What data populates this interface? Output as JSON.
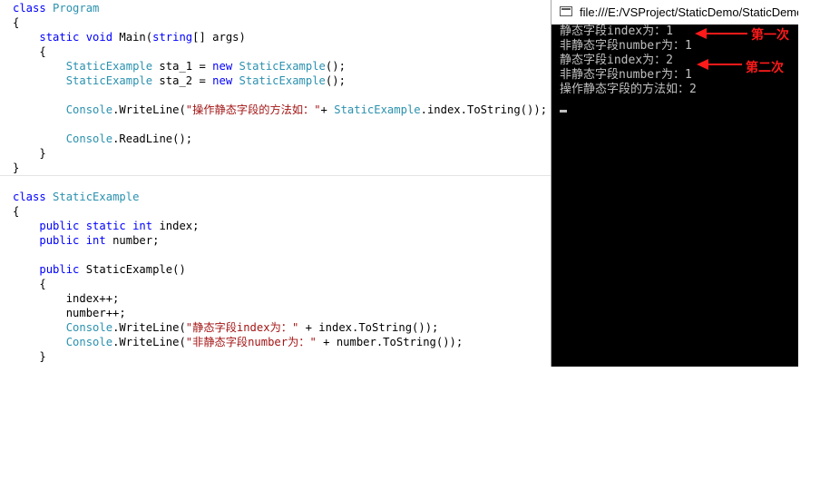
{
  "editor_program": {
    "lines": [
      [
        {
          "t": "class ",
          "c": "kw"
        },
        {
          "t": "Program",
          "c": "tp"
        }
      ],
      [
        {
          "t": "{",
          "c": ""
        }
      ],
      [
        {
          "t": "    ",
          "c": ""
        },
        {
          "t": "static void ",
          "c": "kw"
        },
        {
          "t": "Main(",
          "c": ""
        },
        {
          "t": "string",
          "c": "kw"
        },
        {
          "t": "[] args)",
          "c": ""
        }
      ],
      [
        {
          "t": "    {",
          "c": ""
        }
      ],
      [
        {
          "t": "        ",
          "c": ""
        },
        {
          "t": "StaticExample",
          "c": "tp"
        },
        {
          "t": " sta_1 = ",
          "c": ""
        },
        {
          "t": "new ",
          "c": "kw"
        },
        {
          "t": "StaticExample",
          "c": "tp"
        },
        {
          "t": "();",
          "c": ""
        }
      ],
      [
        {
          "t": "        ",
          "c": ""
        },
        {
          "t": "StaticExample",
          "c": "tp"
        },
        {
          "t": " sta_2 = ",
          "c": ""
        },
        {
          "t": "new ",
          "c": "kw"
        },
        {
          "t": "StaticExample",
          "c": "tp"
        },
        {
          "t": "();",
          "c": ""
        }
      ],
      [
        {
          "t": "",
          "c": ""
        }
      ],
      [
        {
          "t": "        ",
          "c": ""
        },
        {
          "t": "Console",
          "c": "tp"
        },
        {
          "t": ".WriteLine(",
          "c": ""
        },
        {
          "t": "\"操作静态字段的方法如：\"",
          "c": "str"
        },
        {
          "t": "+ ",
          "c": ""
        },
        {
          "t": "StaticExample",
          "c": "tp"
        },
        {
          "t": ".index.ToString());",
          "c": ""
        }
      ],
      [
        {
          "t": "",
          "c": ""
        }
      ],
      [
        {
          "t": "        ",
          "c": ""
        },
        {
          "t": "Console",
          "c": "tp"
        },
        {
          "t": ".ReadLine();",
          "c": ""
        }
      ],
      [
        {
          "t": "    }",
          "c": ""
        }
      ],
      [
        {
          "t": "}",
          "c": ""
        }
      ]
    ]
  },
  "editor_static": {
    "lines": [
      [
        {
          "t": "class ",
          "c": "kw"
        },
        {
          "t": "StaticExample",
          "c": "tp"
        }
      ],
      [
        {
          "t": "{",
          "c": ""
        }
      ],
      [
        {
          "t": "    ",
          "c": ""
        },
        {
          "t": "public static int ",
          "c": "kw"
        },
        {
          "t": "index;",
          "c": ""
        }
      ],
      [
        {
          "t": "    ",
          "c": ""
        },
        {
          "t": "public int ",
          "c": "kw"
        },
        {
          "t": "number;",
          "c": ""
        }
      ],
      [
        {
          "t": "",
          "c": ""
        }
      ],
      [
        {
          "t": "    ",
          "c": ""
        },
        {
          "t": "public ",
          "c": "kw"
        },
        {
          "t": "StaticExample()",
          "c": ""
        }
      ],
      [
        {
          "t": "    {",
          "c": ""
        }
      ],
      [
        {
          "t": "        index++;",
          "c": ""
        }
      ],
      [
        {
          "t": "        number++;",
          "c": ""
        }
      ],
      [
        {
          "t": "        ",
          "c": ""
        },
        {
          "t": "Console",
          "c": "tp"
        },
        {
          "t": ".WriteLine(",
          "c": ""
        },
        {
          "t": "\"静态字段index为：\"",
          "c": "str"
        },
        {
          "t": " + index.ToString());",
          "c": ""
        }
      ],
      [
        {
          "t": "        ",
          "c": ""
        },
        {
          "t": "Console",
          "c": "tp"
        },
        {
          "t": ".WriteLine(",
          "c": ""
        },
        {
          "t": "\"非静态字段number为：\"",
          "c": "str"
        },
        {
          "t": " + number.ToString());",
          "c": ""
        }
      ],
      [
        {
          "t": "    }",
          "c": ""
        }
      ]
    ]
  },
  "console": {
    "title": "file:///E:/VSProject/StaticDemo/StaticDemo",
    "lines": [
      "静态字段index为：1",
      "非静态字段number为：1",
      "静态字段index为：2",
      "非静态字段number为：1",
      "操作静态字段的方法如：2"
    ]
  },
  "annotations": {
    "first": "第一次",
    "second": "第二次"
  },
  "colors": {
    "keyword": "#0000ff",
    "type": "#2b91af",
    "string": "#a31515",
    "console_text": "#c0c0c0",
    "annotation": "#ff1a1a"
  }
}
